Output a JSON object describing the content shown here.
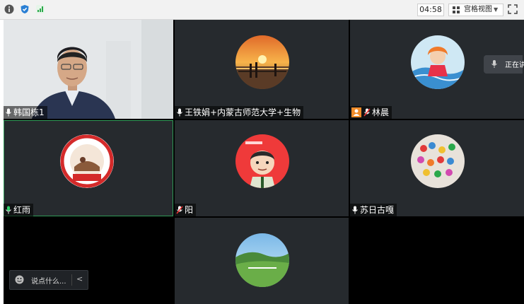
{
  "toolbar": {
    "timer": "04:58",
    "view_mode": "宫格视图",
    "icons": [
      "info-icon",
      "shield-icon",
      "signal-icon",
      "grid-icon",
      "fullscreen-icon"
    ]
  },
  "participants": [
    {
      "name": "韩国栋1",
      "video": true
    },
    {
      "name": "王铁娟+内蒙古师范大学+生物",
      "video": false
    },
    {
      "name": "林晨",
      "video": false,
      "host_badge": true
    },
    {
      "name": "红雨",
      "video": false,
      "active": true
    },
    {
      "name": "阳",
      "video": false
    },
    {
      "name": "苏日古嘎",
      "video": false
    }
  ],
  "speaking_indicator": "正在讲",
  "chat": {
    "placeholder": "说点什么..."
  },
  "colors": {
    "tile_bg": "#262a2e",
    "active_border": "#2f9a57",
    "host_badge": "#f08c2a"
  }
}
